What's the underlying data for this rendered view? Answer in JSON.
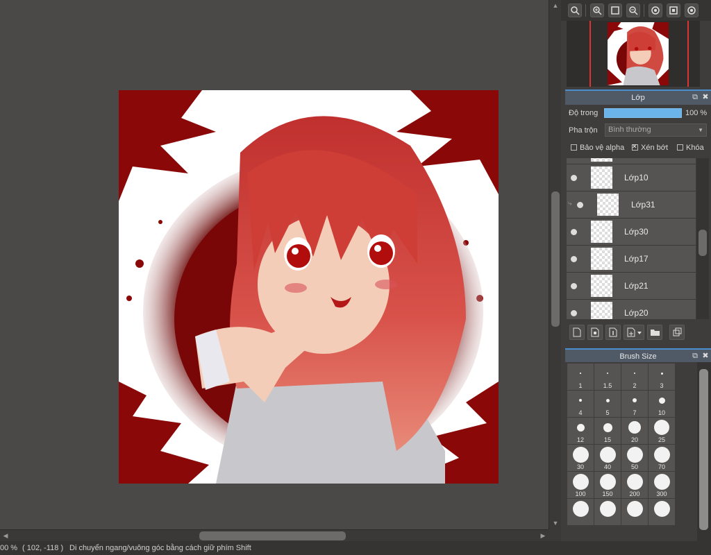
{
  "status": {
    "zoom": "00 %",
    "coords": "( 102, -118 )",
    "hint": "Di chuyển ngang/vuông góc bằng cách giữ phím Shift"
  },
  "layer_panel": {
    "title": "Lớp",
    "opacity_label": "Độ trong",
    "opacity_value": "100 %",
    "opacity_fraction": 1.0,
    "blend_label": "Pha trộn",
    "blend_value": "Bình thường",
    "protect_alpha": "Bảo vệ alpha",
    "clipping": "Xén bớt",
    "lock": "Khóa",
    "layers": [
      {
        "name": "Lớp10",
        "visible": true,
        "clipped": false
      },
      {
        "name": "Lớp31",
        "visible": true,
        "clipped": true
      },
      {
        "name": "Lớp30",
        "visible": true,
        "clipped": false
      },
      {
        "name": "Lớp17",
        "visible": true,
        "clipped": false
      },
      {
        "name": "Lớp21",
        "visible": true,
        "clipped": false
      },
      {
        "name": "Lớp20",
        "visible": true,
        "clipped": false
      }
    ]
  },
  "brush_panel": {
    "title": "Brush Size",
    "sizes": [
      "1",
      "1.5",
      "2",
      "3",
      "4",
      "5",
      "7",
      "10",
      "12",
      "15",
      "20",
      "25",
      "30",
      "40",
      "50",
      "70",
      "100",
      "150",
      "200",
      "300"
    ]
  },
  "colors": {
    "accent": "#4a8fd0",
    "opacity_bar": "#6ab4ea",
    "canvas_bg": "#4a4947",
    "art_red": "#b31b1b"
  },
  "icons": {
    "nav_toolbar": [
      "zoom-fit-icon",
      "zoom-in-icon",
      "fullscreen-icon",
      "zoom-out-icon",
      "rotate-left-icon",
      "reset-view-icon",
      "rotate-right-icon"
    ],
    "layer_toolbar": [
      "new-layer-icon",
      "new-layer-8bit-icon",
      "new-layer-1bit-icon",
      "add-layer-menu-icon",
      "new-folder-icon",
      "duplicate-layer-icon"
    ]
  }
}
